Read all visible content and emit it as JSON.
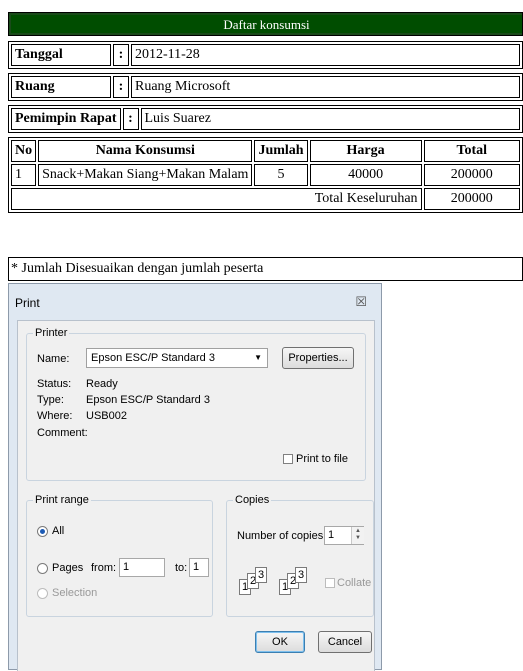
{
  "report": {
    "title": "Daftar konsumsi",
    "info": [
      {
        "label": "Tanggal",
        "sep": ":",
        "value": "2012-11-28"
      },
      {
        "label": "Ruang",
        "sep": ":",
        "value": "Ruang Microsoft"
      },
      {
        "label": "Pemimpin Rapat",
        "sep": ":",
        "value": "Luis Suarez"
      }
    ],
    "table": {
      "headers": [
        "No",
        "Nama Konsumsi",
        "Jumlah",
        "Harga",
        "Total"
      ],
      "rows": [
        {
          "no": "1",
          "nama": "Snack+Makan Siang+Makan Malam",
          "jumlah": "5",
          "harga": "40000",
          "total": "200000"
        }
      ],
      "total_label": "Total Keseluruhan",
      "total_value": "200000"
    },
    "note": "* Jumlah Disesuaikan dengan jumlah peserta"
  },
  "dialog": {
    "title": "Print",
    "close_glyph": "☒",
    "printer": {
      "group_label": "Printer",
      "name_label": "Name:",
      "name_value": "Epson ESC/P Standard 3",
      "properties_label": "Properties...",
      "status_label": "Status:",
      "status_value": "Ready",
      "type_label": "Type:",
      "type_value": "Epson ESC/P Standard 3",
      "where_label": "Where:",
      "where_value": "USB002",
      "comment_label": "Comment:",
      "print_to_file_label": "Print to file"
    },
    "range": {
      "group_label": "Print range",
      "all_label": "All",
      "pages_label": "Pages",
      "from_label": "from:",
      "from_value": "1",
      "to_label": "to:",
      "to_value": "1",
      "selection_label": "Selection"
    },
    "copies": {
      "group_label": "Copies",
      "number_label": "Number of copies:",
      "number_value": "1",
      "collate_label": "Collate",
      "collate_sheets": [
        "1",
        "2",
        "3"
      ]
    },
    "ok_label": "OK",
    "cancel_label": "Cancel"
  }
}
